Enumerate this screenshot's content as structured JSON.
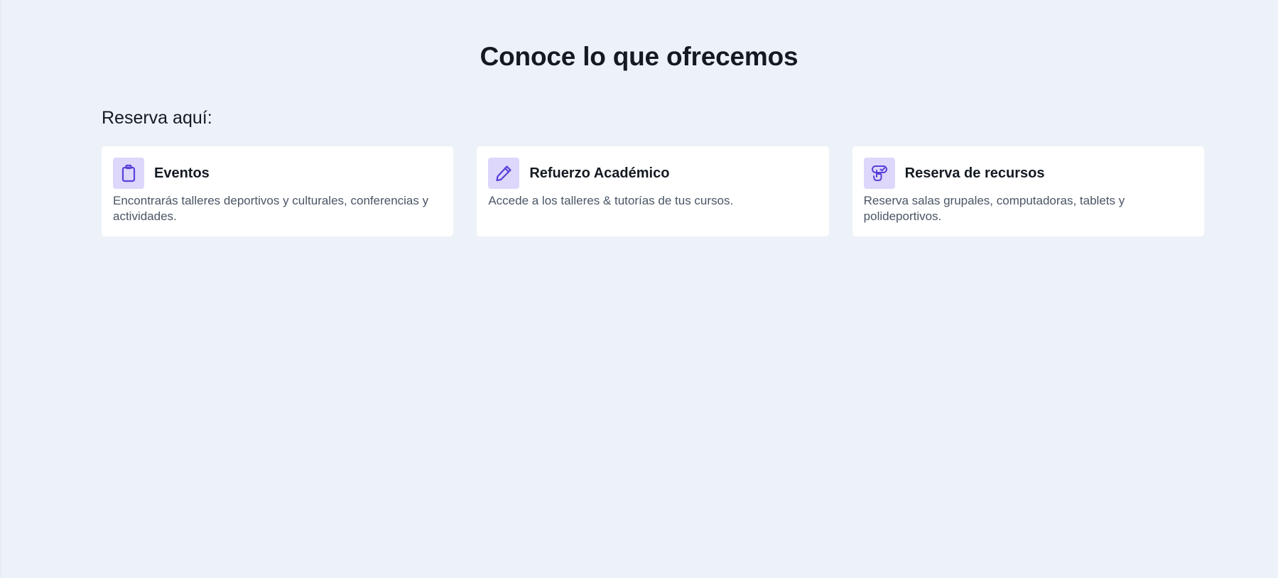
{
  "section": {
    "title": "Conoce lo que ofrecemos",
    "subtitle": "Reserva aquí:"
  },
  "cards": [
    {
      "icon": "clipboard-icon",
      "title": "Eventos",
      "description": "Encontrarás talleres deportivos y culturales, conferencias y actividades."
    },
    {
      "icon": "pencil-icon",
      "title": "Refuerzo Académico",
      "description": "Accede a los talleres & tutorías de tus cursos."
    },
    {
      "icon": "hand-pointer-check-icon",
      "title": "Reserva de recursos",
      "description": "Reserva salas grupales, computadoras, tablets y polideportivos."
    }
  ],
  "colors": {
    "background": "#ECF2F8",
    "card": "#FFFFFF",
    "icon_tile": "#DCD7FB",
    "icon_stroke": "#5B3FD9",
    "heading": "#141A22",
    "body_text": "#4A5565"
  }
}
